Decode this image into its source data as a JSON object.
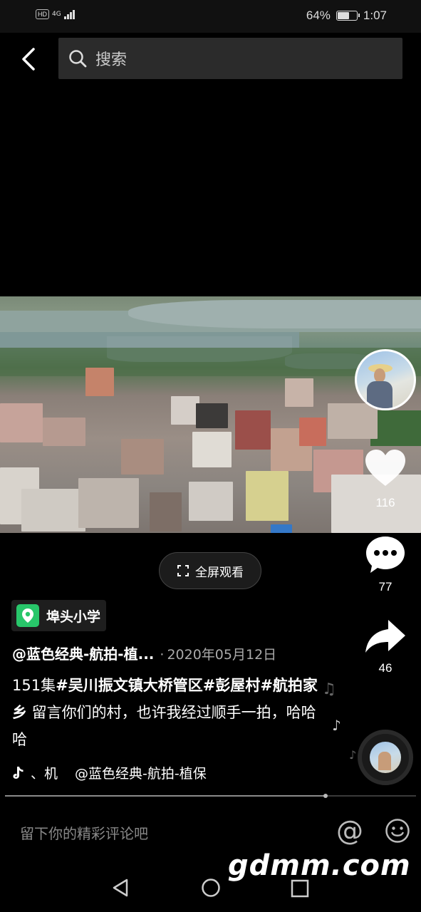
{
  "status_bar": {
    "network_badge": "HD",
    "network_type": "4G",
    "battery_percent": "64%",
    "battery_level": 0.64,
    "time": "1:07"
  },
  "search": {
    "placeholder": "搜索"
  },
  "video": {
    "fullscreen_label": "全屏观看",
    "progress": 0.78
  },
  "actions": {
    "likes": "116",
    "comments": "77",
    "shares": "46"
  },
  "post": {
    "location": "埠头小学",
    "author": "@蓝色经典-航拍-植...",
    "separator": "·",
    "date": "2020年05月12日",
    "caption_prefix": "151集",
    "hashtag_1": "#吴川振文镇大桥管区",
    "hashtag_2": "#彭屋村",
    "hashtag_3": "#航拍家乡",
    "caption_suffix": " 留言你们的村，也许我经过顺手一拍，哈哈哈"
  },
  "music": {
    "title_scroll": "、机",
    "author": "@蓝色经典-航拍-植保"
  },
  "comment_bar": {
    "placeholder": "留下你的精彩评论吧",
    "mention_symbol": "@"
  },
  "watermark": "gdmm.com",
  "icons": {
    "back": "chevron-left-icon",
    "search": "search-icon",
    "like": "heart-icon",
    "comment": "comment-bubble-icon",
    "share": "share-arrow-icon",
    "location": "map-pin-icon",
    "music": "tiktok-note-icon",
    "emoji": "smiley-icon",
    "nav_back": "triangle-back-icon",
    "nav_home": "circle-home-icon",
    "nav_recent": "square-recent-icon"
  },
  "colors": {
    "background": "#000000",
    "location_badge": "#28c66a",
    "search_bg": "#2b2b2b"
  }
}
